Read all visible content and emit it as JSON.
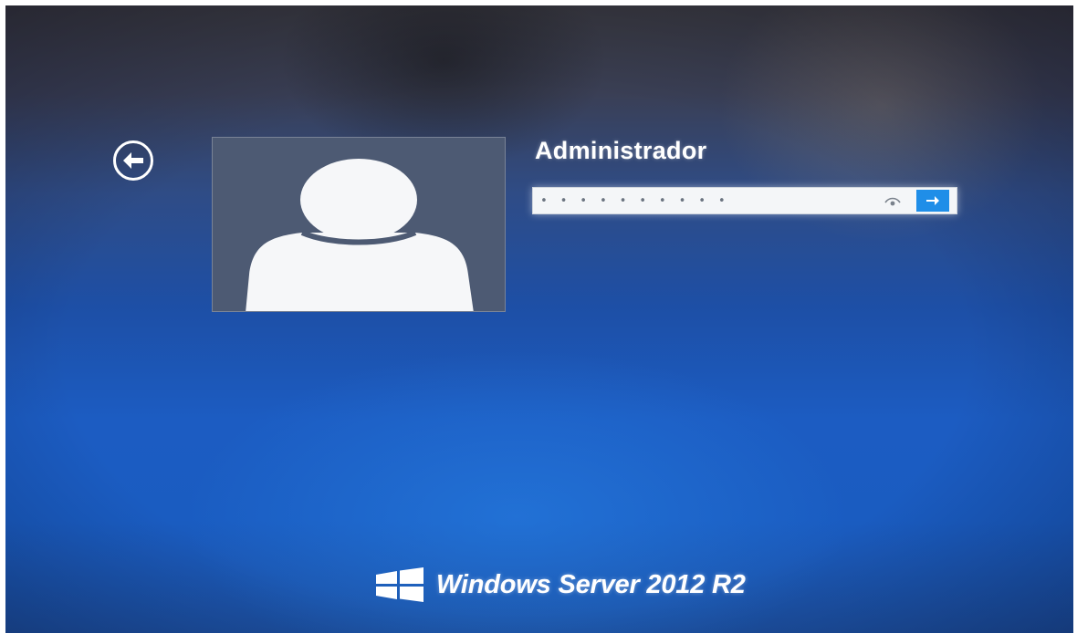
{
  "user": {
    "name": "Administrador",
    "avatar_icon": "user-silhouette-icon"
  },
  "navigation": {
    "back_icon": "arrow-left-circle-icon"
  },
  "password_field": {
    "value": "• • • • • • • • • •",
    "placeholder": "",
    "reveal_icon": "eye-icon",
    "submit_icon": "arrow-right-icon"
  },
  "branding": {
    "logo_icon": "windows-logo-icon",
    "text": "Windows Server 2012 R2"
  },
  "colors": {
    "background_blue": "#1c5cc2",
    "submit_blue": "#1f8ee8",
    "text": "#ffffff",
    "avatar_tile": "#4d5a73"
  }
}
